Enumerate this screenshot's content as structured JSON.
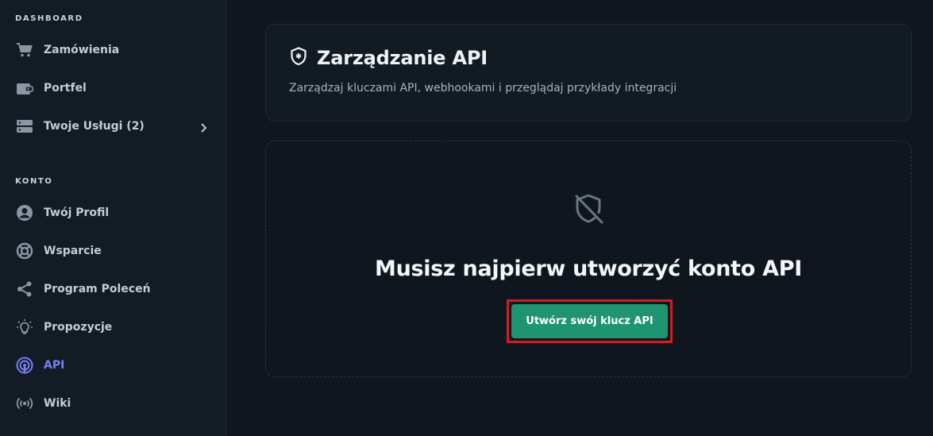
{
  "sidebar": {
    "dashboard_title": "DASHBOARD",
    "account_title": "KONTO",
    "items": [
      {
        "label": "Zamówienia",
        "icon": "cart-icon"
      },
      {
        "label": "Portfel",
        "icon": "wallet-icon"
      },
      {
        "label": "Twoje Usługi (2)",
        "icon": "server-icon"
      },
      {
        "label": "Twój Profil",
        "icon": "user-circle-icon"
      },
      {
        "label": "Wsparcie",
        "icon": "lifebuoy-icon"
      },
      {
        "label": "Program Poleceń",
        "icon": "share-icon"
      },
      {
        "label": "Propozycje",
        "icon": "lightbulb-icon"
      },
      {
        "label": "API",
        "icon": "broadcast-icon",
        "active": true
      },
      {
        "label": "Wiki",
        "icon": "radio-waves-icon"
      }
    ]
  },
  "header": {
    "title": "Zarządzanie API",
    "subtitle": "Zarządzaj kluczami API, webhookami i przeglądaj przykłady integracji"
  },
  "empty_state": {
    "heading": "Musisz najpierw utworzyć konto API",
    "button_label": "Utwórz swój klucz API"
  },
  "colors": {
    "accent": "#7b7ff5",
    "button": "#1e9470",
    "highlight": "#d41c24"
  }
}
